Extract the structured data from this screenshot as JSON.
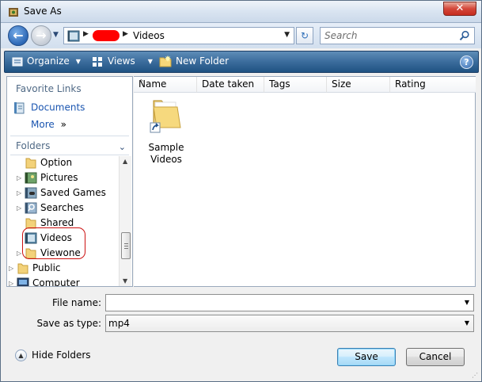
{
  "window": {
    "title": "Save As",
    "close_label": "✕"
  },
  "address_bar": {
    "back_arrow": "←",
    "forward_arrow": "→",
    "recent_dropdown": "▼",
    "crumb_sep_1": "▶",
    "crumb_sep_2": "▶",
    "current_folder": "Videos",
    "dropdown": "▼",
    "refresh_glyph": "↻",
    "search_placeholder": "Search"
  },
  "command_bar": {
    "organize": "Organize",
    "views": "Views",
    "new_folder": "New Folder",
    "dropdown": "▼",
    "help": "?"
  },
  "navigation_pane": {
    "favorite_links_heading": "Favorite Links",
    "favorites": [
      {
        "label": "Documents",
        "icon": "documents-icon"
      }
    ],
    "more_label": "More",
    "more_glyph": "»",
    "folders_heading": "Folders",
    "folders_chevron": "⌄",
    "tree": [
      {
        "label": "Option",
        "icon": "folder-icon",
        "expander": ""
      },
      {
        "label": "Pictures",
        "icon": "pictures-icon",
        "expander": "▷"
      },
      {
        "label": "Saved Games",
        "icon": "saved-games-icon",
        "expander": "▷"
      },
      {
        "label": "Searches",
        "icon": "searches-icon",
        "expander": "▷"
      },
      {
        "label": "Shared",
        "icon": "folder-icon",
        "expander": ""
      },
      {
        "label": "Videos",
        "icon": "videos-icon",
        "expander": ""
      },
      {
        "label": "Viewone",
        "icon": "folder-icon",
        "expander": "▷"
      },
      {
        "label": "Public",
        "icon": "folder-icon",
        "expander": "▷"
      },
      {
        "label": "Computer",
        "icon": "computer-icon",
        "expander": "▷"
      }
    ],
    "scroll_up": "▲",
    "scroll_down": "▼"
  },
  "file_list": {
    "columns": [
      "Name",
      "Date taken",
      "Tags",
      "Size",
      "Rating"
    ],
    "sort_arrow": "^",
    "items": [
      {
        "name_line1": "Sample",
        "name_line2": "Videos",
        "icon": "folder-shortcut-icon"
      }
    ]
  },
  "save_form": {
    "file_name_label": "File name:",
    "file_name_value": "",
    "save_as_type_label": "Save as type:",
    "save_as_type_value": "mp4",
    "dropdown": "▼"
  },
  "footer": {
    "hide_folders": "Hide Folders",
    "hide_folders_glyph": "▲",
    "save_button": "Save",
    "cancel_button": "Cancel",
    "resize_grip": "⋰"
  },
  "colors": {
    "accent": "#1f5282",
    "annotation": "#cc1111",
    "redaction": "#ff0000"
  }
}
